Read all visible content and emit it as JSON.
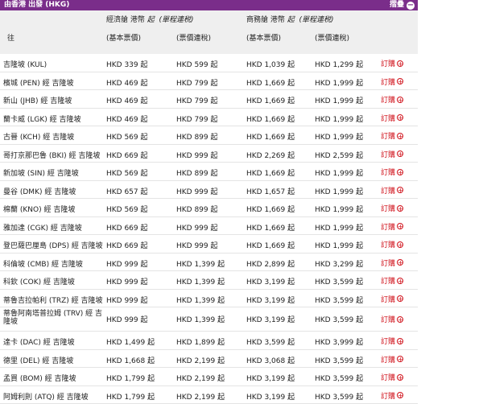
{
  "header": {
    "title": "由香港 出發 (HKG)",
    "collapse_label": "摺疊",
    "collapse_icon": "minus-circle-icon"
  },
  "columns": {
    "destination": "往",
    "economy_title": "經濟艙 港幣",
    "economy_note": "起",
    "economy_trip": "(單程連税)",
    "business_title": "商務艙 港幣",
    "business_note": "起",
    "business_trip": "(單程連税)",
    "base_fare": "(基本票價)",
    "fare_with_tax": "(票價連稅)"
  },
  "book_label": "訂購",
  "book_icon": "plus-circle-icon",
  "rows": [
    {
      "dest": "吉隆坡 (KUL)",
      "eco_base": "HKD 339 起",
      "eco_total": "HKD 599 起",
      "bus_base": "HKD 1,039 起",
      "bus_total": "HKD 1,299 起"
    },
    {
      "dest": "檳城 (PEN) 經 吉隆坡",
      "eco_base": "HKD 469 起",
      "eco_total": "HKD 799 起",
      "bus_base": "HKD 1,669 起",
      "bus_total": "HKD 1,999 起"
    },
    {
      "dest": "新山 (JHB) 經 吉隆坡",
      "eco_base": "HKD 469 起",
      "eco_total": "HKD 799 起",
      "bus_base": "HKD 1,669 起",
      "bus_total": "HKD 1,999 起"
    },
    {
      "dest": "蘭卡威 (LGK) 經 吉隆坡",
      "eco_base": "HKD 469 起",
      "eco_total": "HKD 799 起",
      "bus_base": "HKD 1,669 起",
      "bus_total": "HKD 1,999 起"
    },
    {
      "dest": "古晉 (KCH) 經 吉隆坡",
      "eco_base": "HKD 569 起",
      "eco_total": "HKD 899 起",
      "bus_base": "HKD 1,669 起",
      "bus_total": "HKD 1,999 起"
    },
    {
      "dest": "哥打京那巴魯 (BKI) 經 吉隆坡",
      "eco_base": "HKD 669 起",
      "eco_total": "HKD 999 起",
      "bus_base": "HKD 2,269 起",
      "bus_total": "HKD 2,599 起"
    },
    {
      "dest": "新加坡 (SIN) 經 吉隆坡",
      "eco_base": "HKD 569 起",
      "eco_total": "HKD 899 起",
      "bus_base": "HKD 1,669 起",
      "bus_total": "HKD 1,999 起"
    },
    {
      "dest": "曼谷 (DMK) 經 吉隆坡",
      "eco_base": "HKD 657 起",
      "eco_total": "HKD 999 起",
      "bus_base": "HKD 1,657 起",
      "bus_total": "HKD 1,999 起"
    },
    {
      "dest": "棉蘭 (KNO) 經 吉隆坡",
      "eco_base": "HKD 569 起",
      "eco_total": "HKD 899 起",
      "bus_base": "HKD 1,669 起",
      "bus_total": "HKD 1,999 起"
    },
    {
      "dest": "雅加達 (CGK) 經 吉隆坡",
      "eco_base": "HKD 669 起",
      "eco_total": "HKD 999 起",
      "bus_base": "HKD 1,669 起",
      "bus_total": "HKD 1,999 起"
    },
    {
      "dest": "登巴薩巴厘島 (DPS) 經 吉隆坡",
      "eco_base": "HKD 669 起",
      "eco_total": "HKD 999 起",
      "bus_base": "HKD 1,669 起",
      "bus_total": "HKD 1,999 起"
    },
    {
      "dest": "科倫坡 (CMB) 經 吉隆坡",
      "eco_base": "HKD 999 起",
      "eco_total": "HKD 1,399 起",
      "bus_base": "HKD 2,899 起",
      "bus_total": "HKD 3,299 起"
    },
    {
      "dest": "科欽 (COK) 經 吉隆坡",
      "eco_base": "HKD 999 起",
      "eco_total": "HKD 1,399 起",
      "bus_base": "HKD 3,199 起",
      "bus_total": "HKD 3,599 起"
    },
    {
      "dest": "蒂魯吉拉帕利 (TRZ) 經 吉隆坡",
      "eco_base": "HKD 999 起",
      "eco_total": "HKD 1,399 起",
      "bus_base": "HKD 3,199 起",
      "bus_total": "HKD 3,599 起"
    },
    {
      "dest": "蒂魯阿南塔普拉姆 (TRV) 經 吉隆坡",
      "eco_base": "HKD 999 起",
      "eco_total": "HKD 1,399 起",
      "bus_base": "HKD 3,199 起",
      "bus_total": "HKD 3,599 起",
      "tall": true
    },
    {
      "dest": "達卡 (DAC) 經 吉隆坡",
      "eco_base": "HKD 1,499 起",
      "eco_total": "HKD 1,899 起",
      "bus_base": "HKD 3,599 起",
      "bus_total": "HKD 3,999 起"
    },
    {
      "dest": "德里 (DEL) 經 吉隆坡",
      "eco_base": "HKD 1,668 起",
      "eco_total": "HKD 2,199 起",
      "bus_base": "HKD 3,068 起",
      "bus_total": "HKD 3,599 起"
    },
    {
      "dest": "孟買 (BOM) 經 吉隆坡",
      "eco_base": "HKD 1,799 起",
      "eco_total": "HKD 2,199 起",
      "bus_base": "HKD 3,199 起",
      "bus_total": "HKD 3,599 起"
    },
    {
      "dest": "阿姆利則 (ATQ) 經 吉隆坡",
      "eco_base": "HKD 1,799 起",
      "eco_total": "HKD 2,199 起",
      "bus_base": "HKD 3,199 起",
      "bus_total": "HKD 3,599 起"
    }
  ]
}
